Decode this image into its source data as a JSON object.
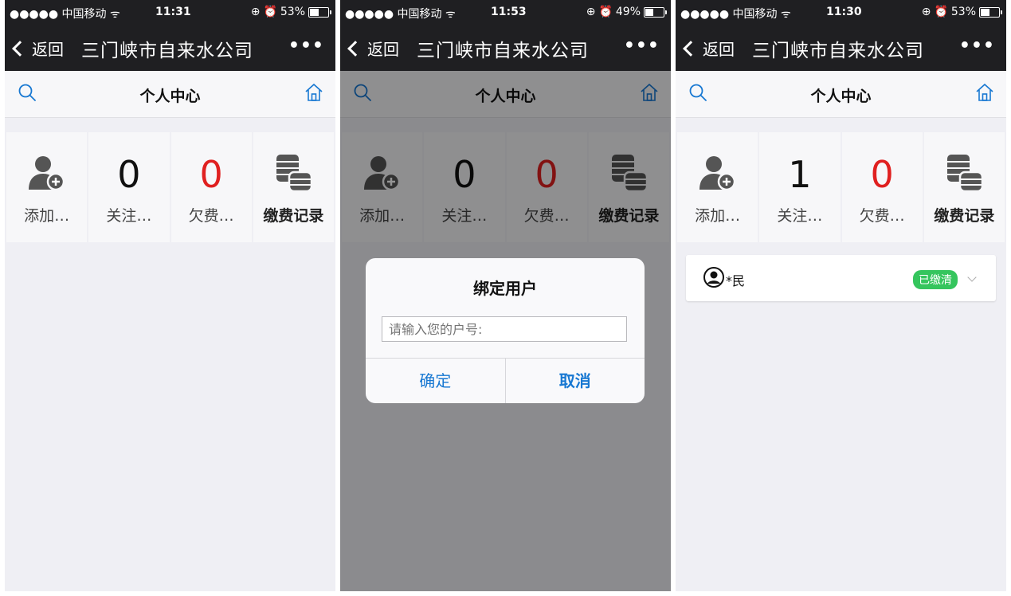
{
  "colors": {
    "accent_blue": "#1878d2",
    "arrears_red": "#e02020",
    "paid_green": "#35c55d",
    "navbar_bg": "#1f1f22"
  },
  "phones": [
    {
      "status": {
        "carrier": "●●●●● 中国移动",
        "time": "11:31",
        "battery": "53%",
        "battery_level": 0.53
      },
      "nav": {
        "back": "返回",
        "title": "三门峡市自来水公司",
        "more": "•••"
      },
      "sub_title": "个人中心",
      "grid": {
        "add_label": "添加…",
        "follow_count": "0",
        "follow_label": "关注…",
        "arrears_count": "0",
        "arrears_label": "欠费…",
        "records_label": "缴费记录"
      }
    },
    {
      "status": {
        "carrier": "●●●●● 中国移动",
        "time": "11:53",
        "battery": "49%",
        "battery_level": 0.49
      },
      "nav": {
        "back": "返回",
        "title": "三门峡市自来水公司",
        "more": "•••"
      },
      "sub_title": "个人中心",
      "grid": {
        "add_label": "添加…",
        "follow_count": "0",
        "follow_label": "关注…",
        "arrears_count": "0",
        "arrears_label": "欠费…",
        "records_label": "缴费记录"
      },
      "dialog": {
        "title": "绑定用户",
        "placeholder": "请输入您的户号:",
        "ok": "确定",
        "cancel": "取消"
      }
    },
    {
      "status": {
        "carrier": "●●●●● 中国移动",
        "time": "11:30",
        "battery": "53%",
        "battery_level": 0.53
      },
      "nav": {
        "back": "返回",
        "title": "三门峡市自来水公司",
        "more": "•••"
      },
      "sub_title": "个人中心",
      "grid": {
        "add_label": "添加…",
        "follow_count": "1",
        "follow_label": "关注…",
        "arrears_count": "0",
        "arrears_label": "欠费…",
        "records_label": "缴费记录"
      },
      "account": {
        "name": "*民",
        "status": "已缴清"
      }
    }
  ],
  "icons": [
    "search-icon",
    "home-icon",
    "add-user-icon",
    "coins-icon",
    "wifi-icon",
    "alarm-icon",
    "user-icon",
    "chevron-down-icon"
  ]
}
